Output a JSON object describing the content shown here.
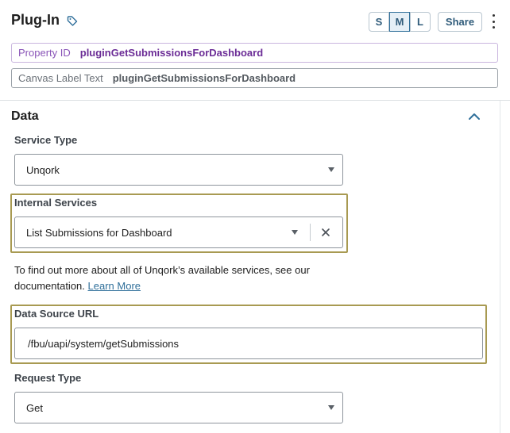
{
  "header": {
    "title": "Plug-In",
    "size_buttons": [
      "S",
      "M",
      "L"
    ],
    "active_size": "M",
    "share_label": "Share"
  },
  "property_id": {
    "label": "Property ID",
    "value": "pluginGetSubmissionsForDashboard"
  },
  "canvas_label": {
    "label": "Canvas Label Text",
    "value": "pluginGetSubmissionsForDashboard"
  },
  "data_section": {
    "title": "Data",
    "service_type": {
      "label": "Service Type",
      "value": "Unqork"
    },
    "internal_services": {
      "label": "Internal Services",
      "value": "List Submissions for Dashboard"
    },
    "help": {
      "text": "To find out more about all of Unqork’s available services, see our documentation.",
      "link": "Learn More"
    },
    "data_source_url": {
      "label": "Data Source URL",
      "value": "/fbu/uapi/system/getSubmissions"
    },
    "request_type": {
      "label": "Request Type",
      "value": "Get"
    }
  },
  "icons": [
    "tag-icon",
    "kebab-menu-icon",
    "chevron-up-icon",
    "dropdown-arrow-icon",
    "clear-icon"
  ],
  "colors": {
    "highlight": "#a89a52",
    "property_accent": "#6b2c96",
    "link": "#2f6f9a"
  }
}
